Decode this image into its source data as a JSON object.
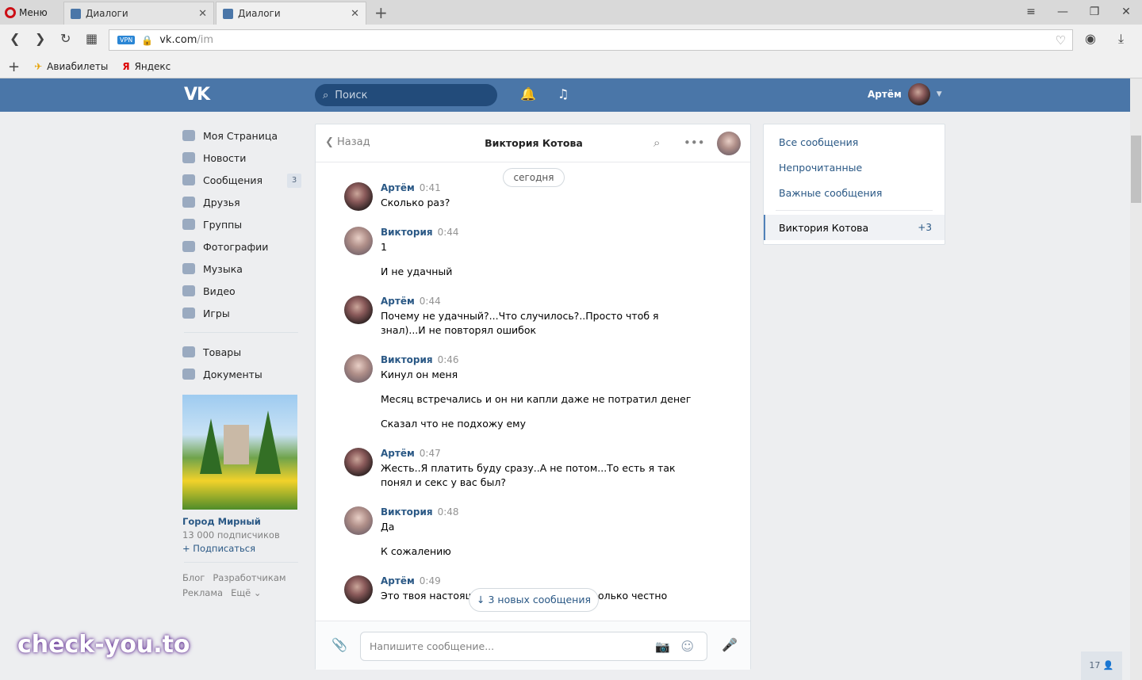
{
  "browser": {
    "menu_label": "Меню",
    "tabs": [
      {
        "title": "Диалоги"
      },
      {
        "title": "Диалоги"
      }
    ],
    "url_domain": "vk.com",
    "url_path": "/im",
    "vpn_label": "VPN",
    "bookmarks": [
      {
        "label": "Авиабилеты"
      },
      {
        "label": "Яндекс"
      }
    ]
  },
  "header": {
    "logo": "VK",
    "search_placeholder": "Поиск",
    "user_name": "Артём"
  },
  "left_nav": {
    "items": [
      {
        "label": "Моя Страница"
      },
      {
        "label": "Новости"
      },
      {
        "label": "Сообщения",
        "badge": "3"
      },
      {
        "label": "Друзья"
      },
      {
        "label": "Группы"
      },
      {
        "label": "Фотографии"
      },
      {
        "label": "Музыка"
      },
      {
        "label": "Видео"
      },
      {
        "label": "Игры"
      }
    ],
    "items2": [
      {
        "label": "Товары"
      },
      {
        "label": "Документы"
      }
    ],
    "ad": {
      "title": "Город Мирный",
      "subs": "13 000 подписчиков",
      "subscribe": "+ Подписаться"
    },
    "footer": [
      "Блог",
      "Разработчикам",
      "Реклама",
      "Ещё ⌄"
    ]
  },
  "chat": {
    "back_label": "Назад",
    "peer_name": "Виктория Котова",
    "date_label": "сегодня",
    "messages": [
      {
        "author": "Артём",
        "time": "0:41",
        "lines": [
          "Сколько раз?"
        ]
      },
      {
        "author": "Виктория",
        "time": "0:44",
        "lines": [
          "1",
          "И не удачный"
        ]
      },
      {
        "author": "Артём",
        "time": "0:44",
        "lines": [
          "Почему не удачный?...Что случилось?..Просто чтоб я знал)...И не повторял ошибок"
        ]
      },
      {
        "author": "Виктория",
        "time": "0:46",
        "lines": [
          "Кинул он меня",
          "Месяц встречались и он ни капли даже не потратил денег",
          "Сказал что не подхожу ему"
        ]
      },
      {
        "author": "Артём",
        "time": "0:47",
        "lines": [
          "Жесть..Я платить буду сразу..А не потом...То есть я так понял и секс у вас был?"
        ]
      },
      {
        "author": "Виктория",
        "time": "0:48",
        "lines": [
          "Да",
          "К сожалению"
        ]
      },
      {
        "author": "Артём",
        "time": "0:49",
        "lines": [
          "Это твоя настоящ",
          "олько честно"
        ]
      }
    ],
    "new_messages_label": "3 новых сообщения",
    "input_placeholder": "Напишите сообщение..."
  },
  "right_menu": {
    "items": [
      "Все сообщения",
      "Непрочитанные",
      "Важные сообщения"
    ],
    "active": {
      "label": "Виктория Котова",
      "count": "+3"
    }
  },
  "overlay": {
    "watermark": "check-you.to",
    "online_count": "17"
  }
}
